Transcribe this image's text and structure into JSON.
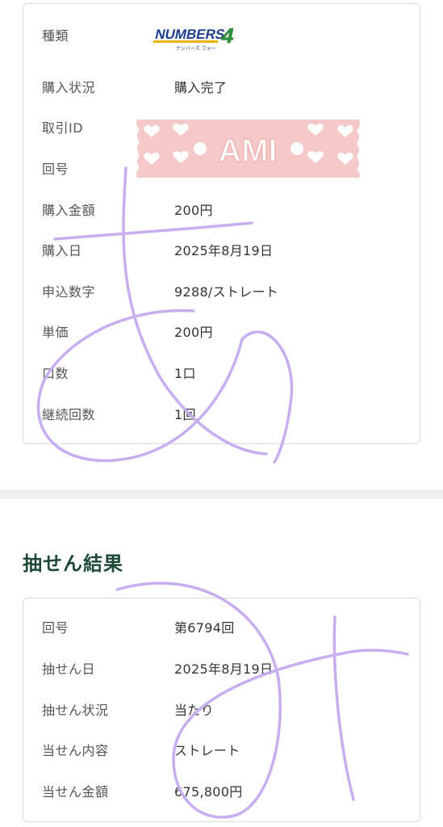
{
  "purchase": {
    "rows": [
      {
        "label": "種類",
        "value": ""
      },
      {
        "label": "購入状況",
        "value": "購入完了"
      },
      {
        "label": "取引ID",
        "value": ""
      },
      {
        "label": "回号",
        "value": ""
      },
      {
        "label": "購入金額",
        "value": "200円"
      },
      {
        "label": "購入日",
        "value": "2025年8月19日"
      },
      {
        "label": "申込数字",
        "value": "9288/ストレート"
      },
      {
        "label": "単価",
        "value": "200円"
      },
      {
        "label": "口数",
        "value": "1口"
      },
      {
        "label": "継続回数",
        "value": "1回"
      }
    ],
    "logo": {
      "main": "NUMBERS",
      "digit": "4",
      "sub": "ナンバーズ フォー"
    },
    "sticker_text": "AMI"
  },
  "result": {
    "title": "抽せん結果",
    "rows": [
      {
        "label": "回号",
        "value": "第6794回"
      },
      {
        "label": "抽せん日",
        "value": "2025年8月19日"
      },
      {
        "label": "抽せん状況",
        "value": "当たり"
      },
      {
        "label": "当せん内容",
        "value": "ストレート"
      },
      {
        "label": "当せん金額",
        "value": "675,800円"
      }
    ]
  },
  "colors": {
    "heading": "#1e4a35",
    "scribble": "#c8aef0",
    "sticker": "#f6c9c9"
  }
}
